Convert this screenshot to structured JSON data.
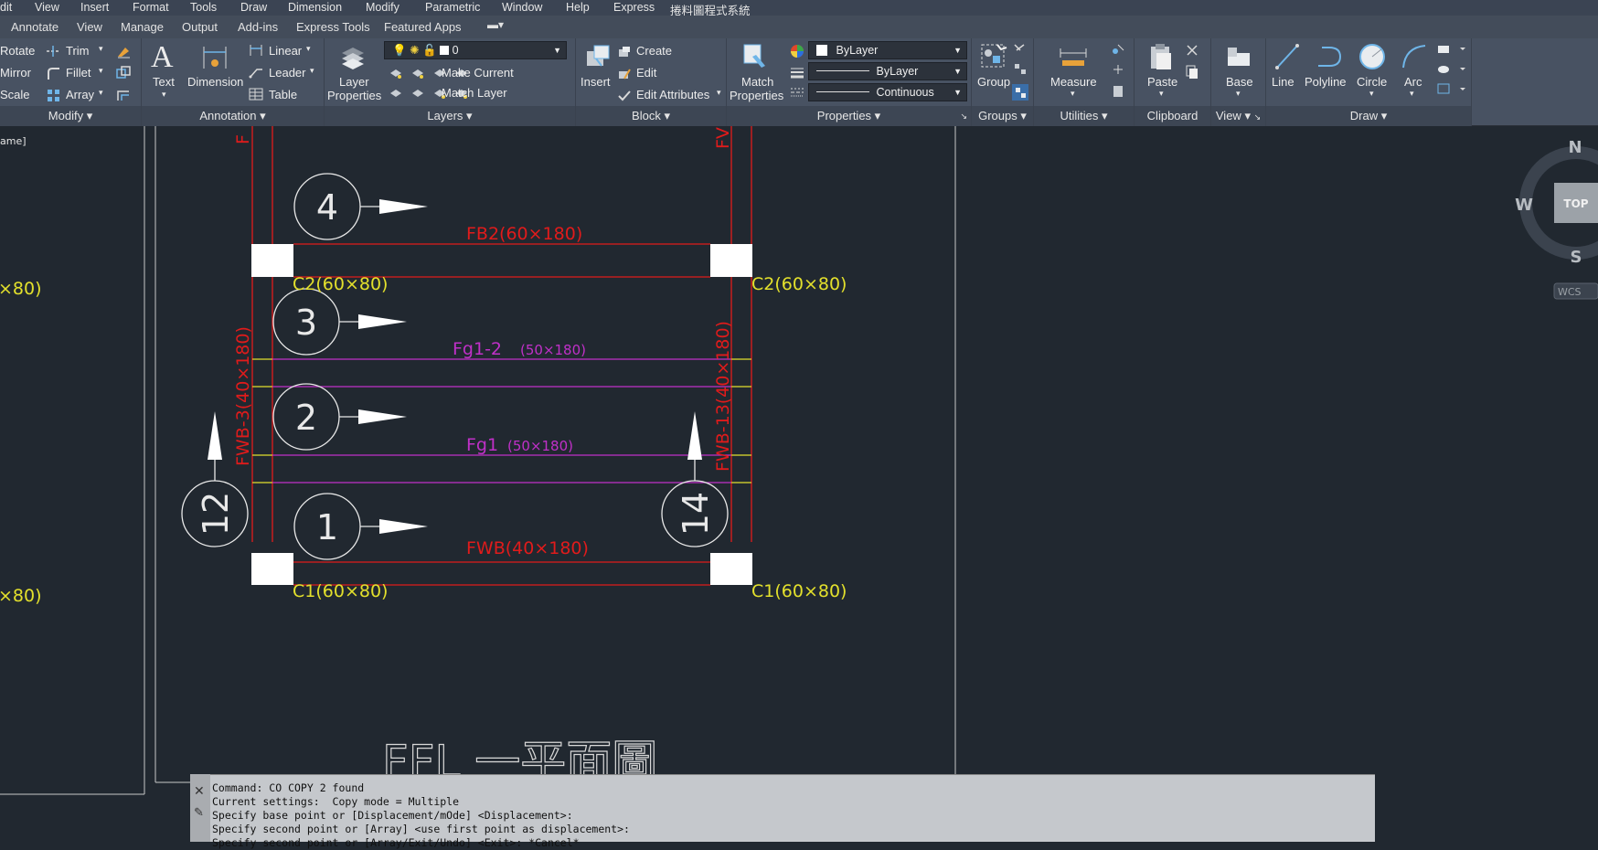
{
  "menubar": [
    "dit",
    "View",
    "Insert",
    "Format",
    "Tools",
    "Draw",
    "Dimension",
    "Modify",
    "Parametric",
    "Window",
    "Help",
    "Express",
    "捲料圖程式系統"
  ],
  "tabs": [
    "Annotate",
    "View",
    "Manage",
    "Output",
    "Add-ins",
    "Express Tools",
    "Featured Apps"
  ],
  "modify": {
    "rotate": "Rotate",
    "mirror": "Mirror",
    "scale": "Scale",
    "trim": "Trim",
    "fillet": "Fillet",
    "array": "Array",
    "title": "Modify"
  },
  "annotation": {
    "text": "Text",
    "dimension": "Dimension",
    "linear": "Linear",
    "leader": "Leader",
    "table": "Table",
    "title": "Annotation"
  },
  "layers": {
    "props1": "Layer",
    "props2": "Properties",
    "current_layer": "0",
    "make_current": "Make Current",
    "match_layer": "Match Layer",
    "title": "Layers"
  },
  "block": {
    "insert": "Insert",
    "create": "Create",
    "edit": "Edit",
    "edit_attr": "Edit Attributes",
    "title": "Block"
  },
  "properties": {
    "match1": "Match",
    "match2": "Properties",
    "color": "ByLayer",
    "lineweight": "ByLayer",
    "linetype": "Continuous",
    "title": "Properties"
  },
  "groups": {
    "group": "Group",
    "title": "Groups"
  },
  "utilities": {
    "measure": "Measure",
    "title": "Utilities"
  },
  "clipboard": {
    "paste": "Paste",
    "title": "Clipboard"
  },
  "view_panel": {
    "base": "Base",
    "title": "View"
  },
  "draw": {
    "line": "Line",
    "polyline": "Polyline",
    "circle": "Circle",
    "arc": "Arc",
    "title": "Draw"
  },
  "drawing": {
    "left_label": "ame]",
    "beam_top": "FB2(60×180)",
    "col_top_left": "C2(60×80)",
    "col_top_right": "C2(60×80)",
    "joist_top": "Fg1-2",
    "joist_top_dim": "(50×180)",
    "joist_bot": "Fg1",
    "joist_bot_dim": "(50×180)",
    "beam_bottom": "FWB(40×180)",
    "col_bot_left": "C1(60×80)",
    "col_bot_right": "C1(60×80)",
    "wall_left": "FWB-3(40×180)",
    "wall_right": "FWB-13(40×180)",
    "wall_left_top": "F",
    "wall_right_top": "FV",
    "partial_left_top": "×80)",
    "partial_left_bot": "×80)",
    "marks": [
      "4",
      "3",
      "2",
      "1",
      "12",
      "14"
    ],
    "plan_title": "FFL 一平面圖"
  },
  "viewcube": {
    "n": "N",
    "w": "W",
    "s": "S",
    "top": "TOP",
    "wcs": "WCS"
  },
  "command_lines": [
    "Command: CO COPY 2 found",
    "Current settings:  Copy mode = Multiple",
    "Specify base point or [Displacement/mOde] <Displacement>:",
    "Specify second point or [Array] <use first point as displacement>:",
    "Specify second point or [Array/Exit/Undo] <Exit>: *Cancel*"
  ],
  "colors": {
    "red": "#e01b1b",
    "yellow": "#e3e02c",
    "magenta": "#c030c8",
    "white": "#e8e8e8"
  }
}
